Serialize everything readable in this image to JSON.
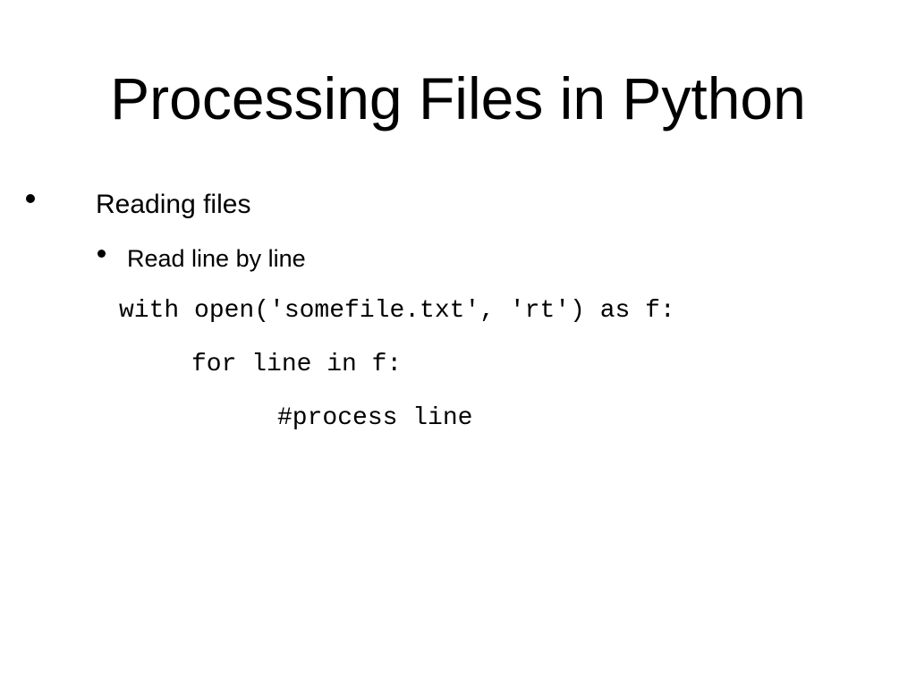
{
  "slide": {
    "title": "Processing Files in Python",
    "bullets": [
      {
        "text": "Reading files",
        "children": [
          {
            "text": "Read line by line"
          }
        ]
      }
    ],
    "code_lines": [
      "with open('somefile.txt', 'rt') as f:",
      "for line in f:",
      "#process line"
    ]
  }
}
